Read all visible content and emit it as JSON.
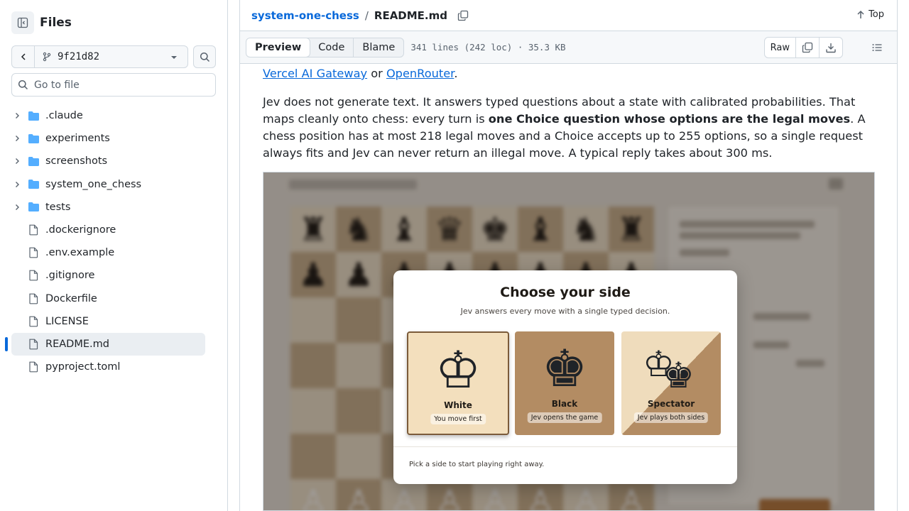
{
  "sidebar": {
    "title": "Files",
    "branch": "9f21d82",
    "search_placeholder": "Go to file",
    "items": [
      {
        "label": ".claude",
        "type": "folder"
      },
      {
        "label": "experiments",
        "type": "folder"
      },
      {
        "label": "screenshots",
        "type": "folder"
      },
      {
        "label": "system_one_chess",
        "type": "folder"
      },
      {
        "label": "tests",
        "type": "folder"
      },
      {
        "label": ".dockerignore",
        "type": "file"
      },
      {
        "label": ".env.example",
        "type": "file"
      },
      {
        "label": ".gitignore",
        "type": "file"
      },
      {
        "label": "Dockerfile",
        "type": "file"
      },
      {
        "label": "LICENSE",
        "type": "file"
      },
      {
        "label": "README.md",
        "type": "file",
        "selected": true
      },
      {
        "label": "pyproject.toml",
        "type": "file"
      }
    ]
  },
  "header": {
    "repo": "system-one-chess",
    "separator": "/",
    "file": "README.md",
    "top_label": "Top"
  },
  "toolbar": {
    "tabs": [
      "Preview",
      "Code",
      "Blame"
    ],
    "active_tab": "Preview",
    "meta": "341 lines (242 loc) · 35.3 KB",
    "raw_label": "Raw"
  },
  "content": {
    "line1_link1": "Vercel AI Gateway",
    "line1_or": " or ",
    "line1_link2": "OpenRouter",
    "line1_end": ".",
    "p2_before": "Jev does not generate text. It answers typed questions about a state with calibrated probabilities. That maps cleanly onto chess: every turn is ",
    "p2_bold": "one Choice question whose options are the legal moves",
    "p2_after": ". A chess position has at most 218 legal moves and a Choice accepts up to 255 options, so a single request always fits and Jev can never return an illegal move. A typical reply takes about 300 ms."
  },
  "screenshot": {
    "modal_title": "Choose your side",
    "modal_subtitle": "Jev answers every move with a single typed decision.",
    "options": [
      {
        "name": "White",
        "caption": "You move first"
      },
      {
        "name": "Black",
        "caption": "Jev opens the game"
      },
      {
        "name": "Spectator",
        "caption": "Jev plays both sides"
      }
    ],
    "footer": "Pick a side to start playing right away."
  },
  "colors": {
    "accent": "#0969da",
    "border": "#d1d9e0",
    "folder": "#54aeff",
    "light_square": "#efe3cd",
    "dark_square": "#c9b08d"
  }
}
